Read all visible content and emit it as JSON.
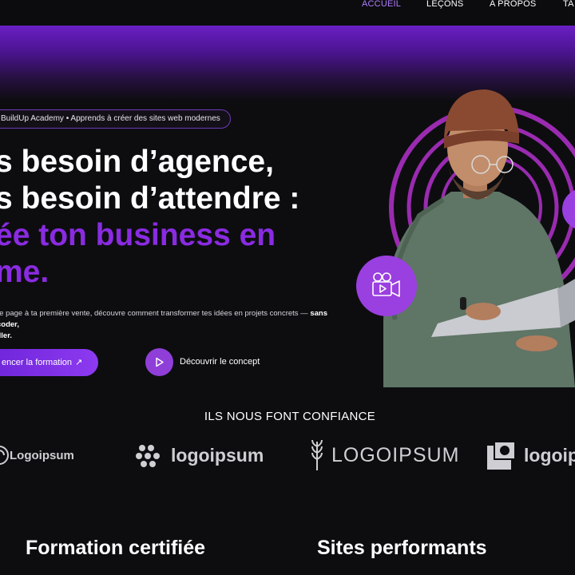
{
  "nav": {
    "items": [
      "ACCUEIL",
      "LEÇONS",
      "A PROPOS",
      "TA"
    ],
    "active": "ACCUEIL"
  },
  "badge": "BuildUp Academy • Apprends à créer des sites web modernes",
  "hero": {
    "line1": "s besoin d’agence,",
    "line2": "s besoin d’attendre :",
    "line3": "ée ton business en",
    "line4": "me.",
    "lead_text": "re page à ta première vente, découvre comment transformer tes idées en projets concrets — ",
    "lead_bold1": "sans coder,",
    "lead_bold2": "iller."
  },
  "buttons": {
    "start": "encer la formation",
    "start_arrow": "↗",
    "discover": "Découvrir le concept"
  },
  "trust": {
    "title": "ILS NOUS FONT CONFIANCE",
    "logos": [
      "Logoipsum",
      "logoipsum",
      "LOGOIPSUM",
      "logoip"
    ]
  },
  "features": [
    "Formation certifiée",
    "Sites performants"
  ],
  "colors": {
    "accent": "#8a2be2",
    "nav_active": "#b07cff",
    "background": "#0d0d10",
    "bubble": "#9a3fe0"
  },
  "icons": [
    "arrow-up-right-icon",
    "play-icon",
    "video-camera-icon"
  ]
}
